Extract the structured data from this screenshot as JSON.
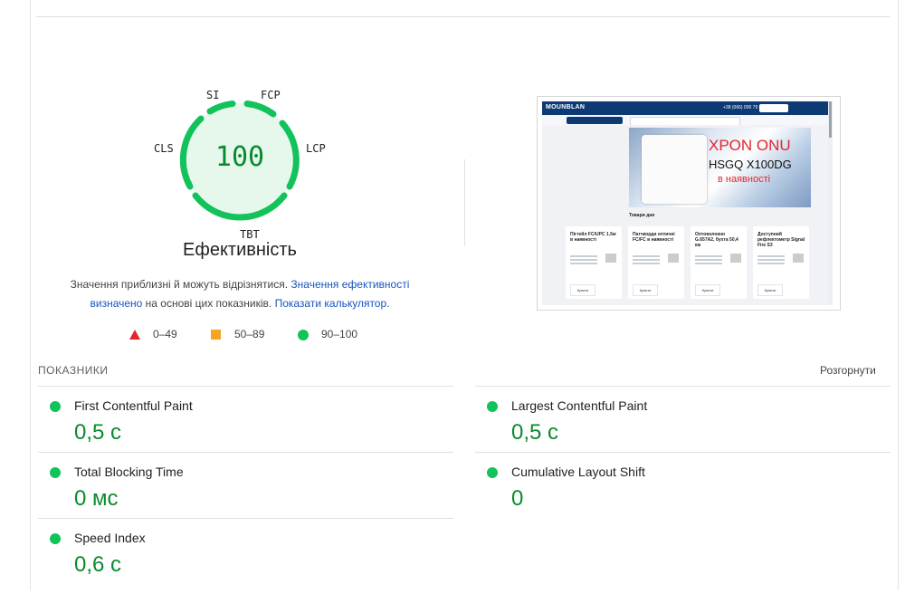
{
  "gauge": {
    "score": "100",
    "labels": {
      "si": "SI",
      "fcp": "FCP",
      "cls": "CLS",
      "lcp": "LCP",
      "tbt": "TBT"
    },
    "color": "#12c25a"
  },
  "performance": {
    "title": "Ефективність",
    "note_prefix": "Значення приблизні й можуть відрізнятися. ",
    "note_link1": "Значення ефективності визначено",
    "note_middle": " на основі цих показників. ",
    "note_link2": "Показати калькулятор",
    "note_suffix": "."
  },
  "legend": [
    {
      "range": "0–49",
      "shape": "triangle",
      "color": "#e3262e"
    },
    {
      "range": "50–89",
      "shape": "square",
      "color": "#f4a623"
    },
    {
      "range": "90–100",
      "shape": "circle",
      "color": "#12c25a"
    }
  ],
  "screenshot": {
    "logo": "MOUNBLAN",
    "phone": "+38 (066) 000 79 91",
    "banner_line1": "XPON ONU",
    "banner_line2": "HSGQ X100DG",
    "banner_line3": "в наявності",
    "goods_title": "Товари дня",
    "cards": [
      {
        "title": "Пігтейл FC/UPC 1.5м в наявності",
        "button": "Купити"
      },
      {
        "title": "Патчкорди оптичні FC/FC в наявності",
        "button": "Купити"
      },
      {
        "title": "Оптоволокно G.657A2, бухта 50,4 км",
        "button": "Купити"
      },
      {
        "title": "Доступний рефлектометр Signal Fire S3",
        "button": "Купити"
      }
    ]
  },
  "metrics": {
    "header": "ПОКАЗНИКИ",
    "expand_label": "Розгорнути",
    "items": [
      {
        "label": "First Contentful Paint",
        "value": "0,5 с"
      },
      {
        "label": "Largest Contentful Paint",
        "value": "0,5 с"
      },
      {
        "label": "Total Blocking Time",
        "value": "0 мс"
      },
      {
        "label": "Cumulative Layout Shift",
        "value": "0"
      },
      {
        "label": "Speed Index",
        "value": "0,6 с"
      }
    ]
  }
}
